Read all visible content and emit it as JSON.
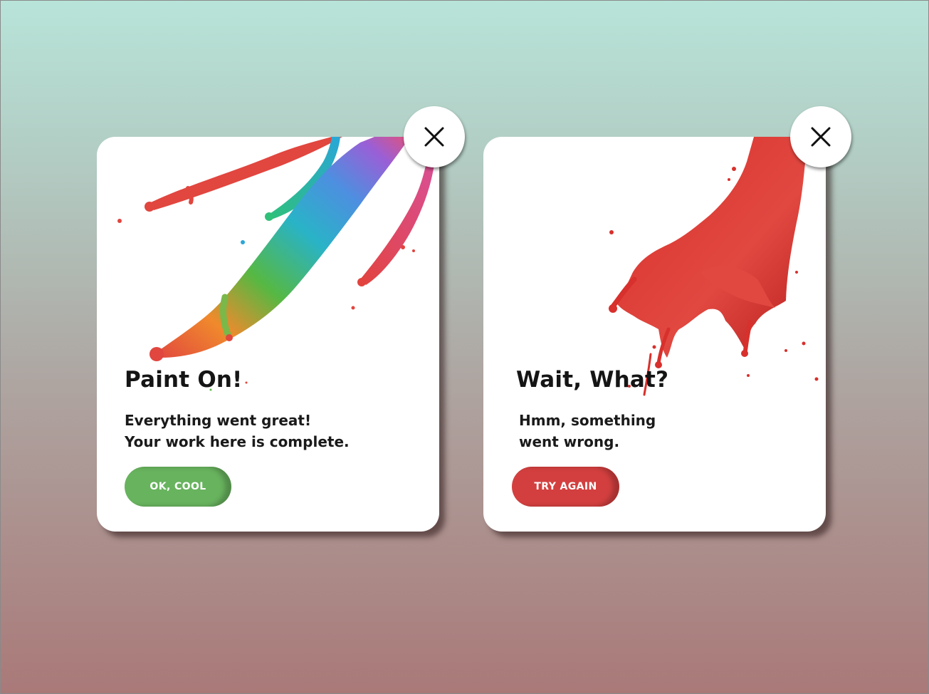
{
  "cards": [
    {
      "title": "Paint On!",
      "message_lines": [
        "Everything went great!",
        "Your work here is complete."
      ],
      "button_label": "OK, COOL",
      "button_color": "#68b35e",
      "close_icon": "close-icon"
    },
    {
      "title": "Wait, What?",
      "message_lines": [
        "Hmm, something",
        "went wrong."
      ],
      "button_label": "TRY AGAIN",
      "button_color": "#d33f3f",
      "close_icon": "close-icon"
    }
  ],
  "colors": {
    "background_top": "#b8e4d9",
    "background_bottom": "#a97978",
    "card": "#ffffff",
    "text": "#151515",
    "success": "#68b35e",
    "error": "#d33f3f"
  }
}
